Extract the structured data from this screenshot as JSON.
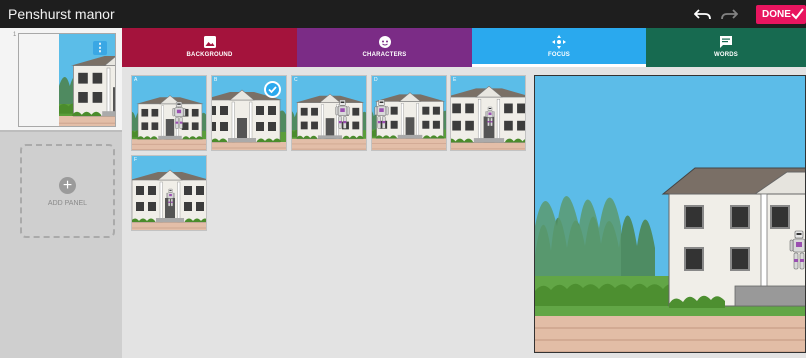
{
  "app": {
    "title": "Penshurst manor"
  },
  "toolbar": {
    "undo_icon": "undo-icon",
    "redo_icon": "redo-icon",
    "done_label": "DONE"
  },
  "panels": [
    {
      "number": "1"
    }
  ],
  "add_panel": {
    "label": "ADD PANEL"
  },
  "tabs": [
    {
      "label": "BACKGROUND",
      "icon": "image-icon",
      "color": "#a4133c"
    },
    {
      "label": "CHARACTERS",
      "icon": "character-icon",
      "color": "#7b2c86"
    },
    {
      "label": "FOCUS",
      "icon": "focus-arrows-icon",
      "color": "#2aa9ee",
      "active": true
    },
    {
      "label": "WORDS",
      "icon": "speech-bubble-icon",
      "color": "#176a50"
    }
  ],
  "focus_options": [
    {
      "letter": "A",
      "selected": false
    },
    {
      "letter": "B",
      "selected": true
    },
    {
      "letter": "C",
      "selected": false
    },
    {
      "letter": "D",
      "selected": false
    },
    {
      "letter": "E",
      "selected": false
    },
    {
      "letter": "F",
      "selected": false
    }
  ],
  "colors": {
    "accent": "#e8155f",
    "focus_blue": "#2aa9ee",
    "topbar": "#1e1e1e"
  }
}
